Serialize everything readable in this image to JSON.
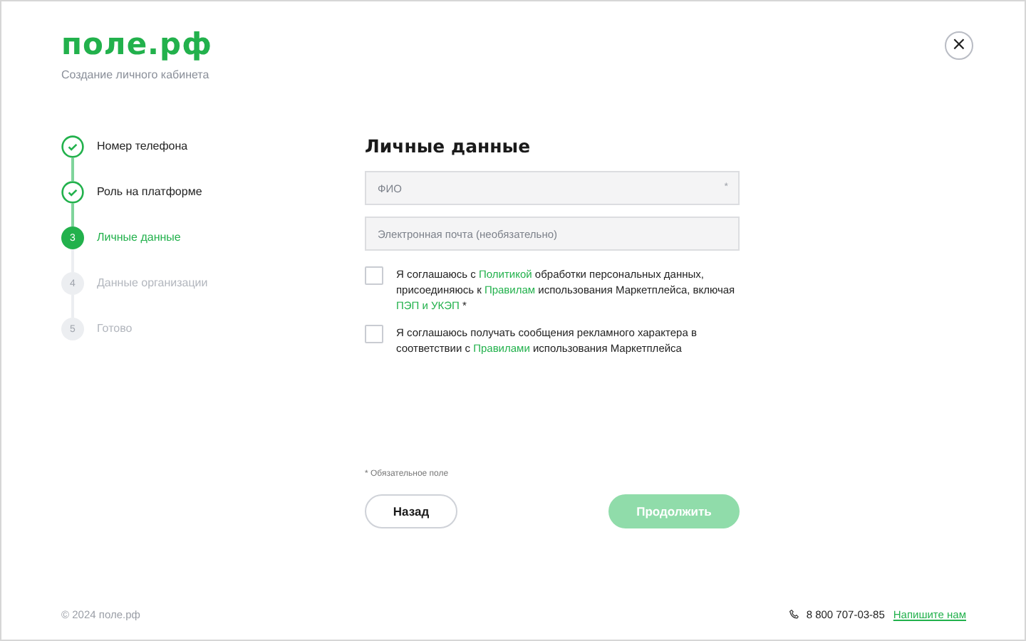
{
  "logo": "поле.рф",
  "subtitle": "Создание личного кабинета",
  "close_button": {
    "label": "×"
  },
  "steps": [
    {
      "kind": "done",
      "label": "Номер телефона"
    },
    {
      "kind": "done",
      "label": "Роль на платформе"
    },
    {
      "kind": "current",
      "number": "3",
      "label": "Личные данные"
    },
    {
      "kind": "pending",
      "number": "4",
      "label": "Данные организации"
    },
    {
      "kind": "pending",
      "number": "5",
      "label": "Готово"
    }
  ],
  "form": {
    "title": "Личные данные",
    "fields": [
      {
        "placeholder": "ФИО",
        "required_mark": "*"
      },
      {
        "placeholder": "Электронная почта (необязательно)"
      }
    ],
    "agreements": [
      {
        "checked": false,
        "parts": [
          {
            "kind": "text",
            "text": "Я соглашаюсь с "
          },
          {
            "kind": "link",
            "text": "Политикой"
          },
          {
            "kind": "text",
            "text": " обработки персональных данных, присоединяюсь к "
          },
          {
            "kind": "link",
            "text": "Правилам"
          },
          {
            "kind": "text",
            "text": " использования Маркетплейса, включая "
          },
          {
            "kind": "link",
            "text": "ПЭП и УКЭП"
          },
          {
            "kind": "text",
            "text": " *"
          }
        ]
      },
      {
        "checked": false,
        "parts": [
          {
            "kind": "text",
            "text": "Я соглашаюсь получать сообщения рекламного характера в соответствии с "
          },
          {
            "kind": "link",
            "text": "Правилами"
          },
          {
            "kind": "text",
            "text": " использования Маркетплейса"
          }
        ]
      }
    ],
    "required_note": "*  Обязательное поле",
    "back_button": "Назад",
    "continue_button": {
      "label": "Продолжить",
      "disabled": true
    }
  },
  "footer": {
    "copyright": "© 2024 поле.рф",
    "phone": "8 800 707-03-85",
    "contact_link": "Напишите нам"
  }
}
